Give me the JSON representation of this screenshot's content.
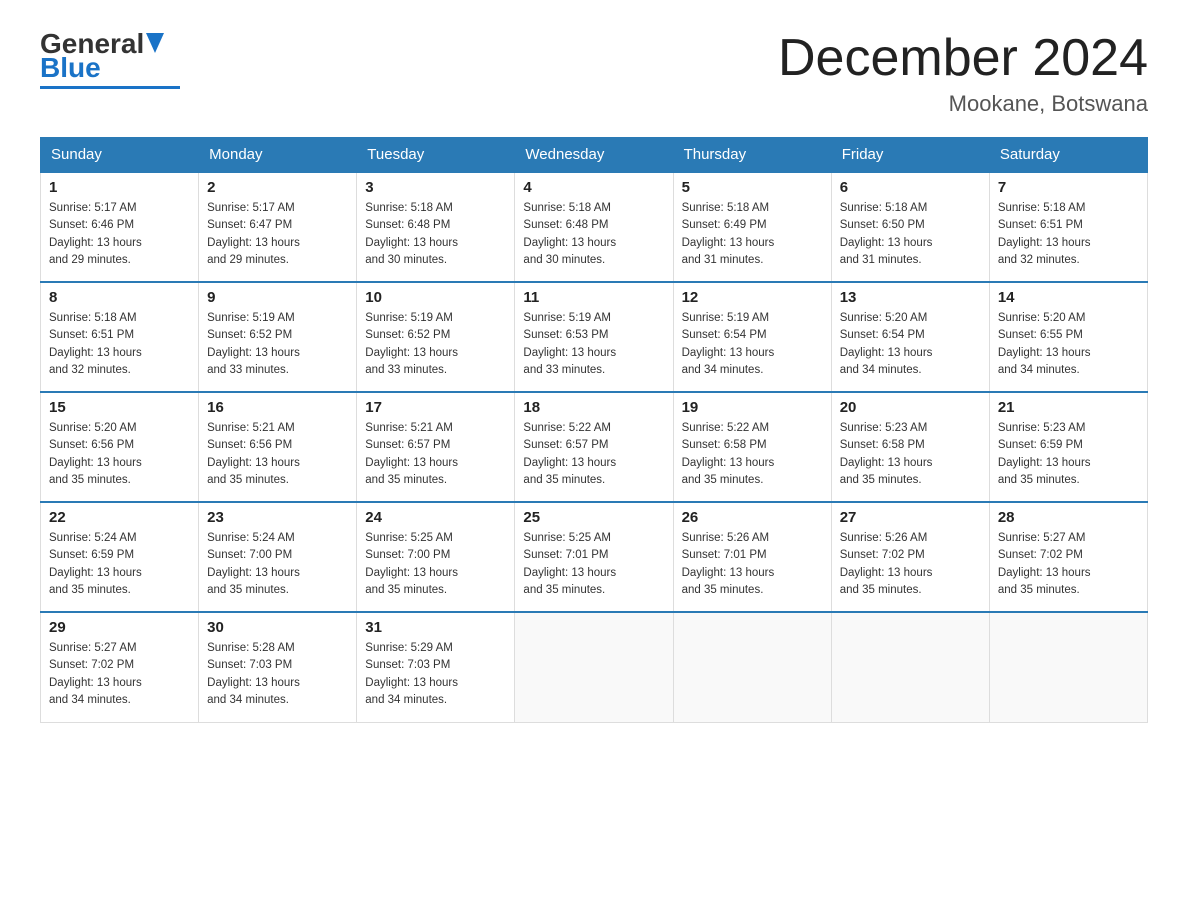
{
  "logo": {
    "general": "General",
    "blue": "Blue",
    "underline_color": "#1a73c7"
  },
  "title": "December 2024",
  "subtitle": "Mookane, Botswana",
  "days_of_week": [
    "Sunday",
    "Monday",
    "Tuesday",
    "Wednesday",
    "Thursday",
    "Friday",
    "Saturday"
  ],
  "weeks": [
    [
      {
        "day": "1",
        "sunrise": "5:17 AM",
        "sunset": "6:46 PM",
        "daylight": "13 hours and 29 minutes."
      },
      {
        "day": "2",
        "sunrise": "5:17 AM",
        "sunset": "6:47 PM",
        "daylight": "13 hours and 29 minutes."
      },
      {
        "day": "3",
        "sunrise": "5:18 AM",
        "sunset": "6:48 PM",
        "daylight": "13 hours and 30 minutes."
      },
      {
        "day": "4",
        "sunrise": "5:18 AM",
        "sunset": "6:48 PM",
        "daylight": "13 hours and 30 minutes."
      },
      {
        "day": "5",
        "sunrise": "5:18 AM",
        "sunset": "6:49 PM",
        "daylight": "13 hours and 31 minutes."
      },
      {
        "day": "6",
        "sunrise": "5:18 AM",
        "sunset": "6:50 PM",
        "daylight": "13 hours and 31 minutes."
      },
      {
        "day": "7",
        "sunrise": "5:18 AM",
        "sunset": "6:51 PM",
        "daylight": "13 hours and 32 minutes."
      }
    ],
    [
      {
        "day": "8",
        "sunrise": "5:18 AM",
        "sunset": "6:51 PM",
        "daylight": "13 hours and 32 minutes."
      },
      {
        "day": "9",
        "sunrise": "5:19 AM",
        "sunset": "6:52 PM",
        "daylight": "13 hours and 33 minutes."
      },
      {
        "day": "10",
        "sunrise": "5:19 AM",
        "sunset": "6:52 PM",
        "daylight": "13 hours and 33 minutes."
      },
      {
        "day": "11",
        "sunrise": "5:19 AM",
        "sunset": "6:53 PM",
        "daylight": "13 hours and 33 minutes."
      },
      {
        "day": "12",
        "sunrise": "5:19 AM",
        "sunset": "6:54 PM",
        "daylight": "13 hours and 34 minutes."
      },
      {
        "day": "13",
        "sunrise": "5:20 AM",
        "sunset": "6:54 PM",
        "daylight": "13 hours and 34 minutes."
      },
      {
        "day": "14",
        "sunrise": "5:20 AM",
        "sunset": "6:55 PM",
        "daylight": "13 hours and 34 minutes."
      }
    ],
    [
      {
        "day": "15",
        "sunrise": "5:20 AM",
        "sunset": "6:56 PM",
        "daylight": "13 hours and 35 minutes."
      },
      {
        "day": "16",
        "sunrise": "5:21 AM",
        "sunset": "6:56 PM",
        "daylight": "13 hours and 35 minutes."
      },
      {
        "day": "17",
        "sunrise": "5:21 AM",
        "sunset": "6:57 PM",
        "daylight": "13 hours and 35 minutes."
      },
      {
        "day": "18",
        "sunrise": "5:22 AM",
        "sunset": "6:57 PM",
        "daylight": "13 hours and 35 minutes."
      },
      {
        "day": "19",
        "sunrise": "5:22 AM",
        "sunset": "6:58 PM",
        "daylight": "13 hours and 35 minutes."
      },
      {
        "day": "20",
        "sunrise": "5:23 AM",
        "sunset": "6:58 PM",
        "daylight": "13 hours and 35 minutes."
      },
      {
        "day": "21",
        "sunrise": "5:23 AM",
        "sunset": "6:59 PM",
        "daylight": "13 hours and 35 minutes."
      }
    ],
    [
      {
        "day": "22",
        "sunrise": "5:24 AM",
        "sunset": "6:59 PM",
        "daylight": "13 hours and 35 minutes."
      },
      {
        "day": "23",
        "sunrise": "5:24 AM",
        "sunset": "7:00 PM",
        "daylight": "13 hours and 35 minutes."
      },
      {
        "day": "24",
        "sunrise": "5:25 AM",
        "sunset": "7:00 PM",
        "daylight": "13 hours and 35 minutes."
      },
      {
        "day": "25",
        "sunrise": "5:25 AM",
        "sunset": "7:01 PM",
        "daylight": "13 hours and 35 minutes."
      },
      {
        "day": "26",
        "sunrise": "5:26 AM",
        "sunset": "7:01 PM",
        "daylight": "13 hours and 35 minutes."
      },
      {
        "day": "27",
        "sunrise": "5:26 AM",
        "sunset": "7:02 PM",
        "daylight": "13 hours and 35 minutes."
      },
      {
        "day": "28",
        "sunrise": "5:27 AM",
        "sunset": "7:02 PM",
        "daylight": "13 hours and 35 minutes."
      }
    ],
    [
      {
        "day": "29",
        "sunrise": "5:27 AM",
        "sunset": "7:02 PM",
        "daylight": "13 hours and 34 minutes."
      },
      {
        "day": "30",
        "sunrise": "5:28 AM",
        "sunset": "7:03 PM",
        "daylight": "13 hours and 34 minutes."
      },
      {
        "day": "31",
        "sunrise": "5:29 AM",
        "sunset": "7:03 PM",
        "daylight": "13 hours and 34 minutes."
      },
      null,
      null,
      null,
      null
    ]
  ],
  "labels": {
    "sunrise": "Sunrise:",
    "sunset": "Sunset:",
    "daylight": "Daylight:"
  }
}
